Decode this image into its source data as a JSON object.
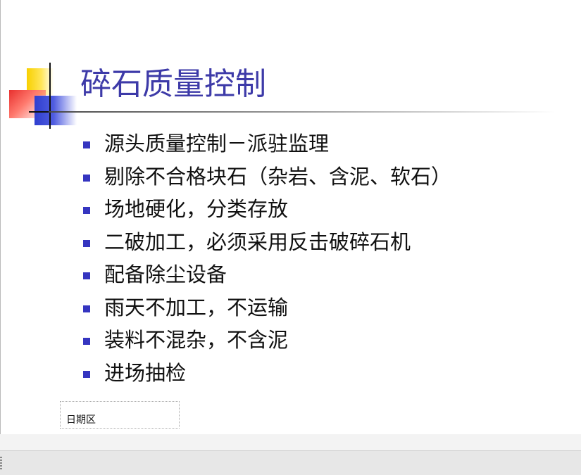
{
  "slide": {
    "title": "碎石质量控制",
    "bullets": [
      "源头质量控制－派驻监理",
      "剔除不合格块石（杂岩、含泥、软石）",
      "场地硬化，分类存放",
      "二破加工，必须采用反击破碎石机",
      "配备除尘设备",
      "雨天不加工，不运输",
      "装料不混杂，不含泥",
      "进场抽检"
    ],
    "date_placeholder": "日期区"
  },
  "colors": {
    "title": "#3d3aa8",
    "bullet": "#3535c0",
    "logo_yellow": "#f8d000",
    "logo_red": "#e8302e",
    "logo_blue": "#2f3fcf"
  }
}
